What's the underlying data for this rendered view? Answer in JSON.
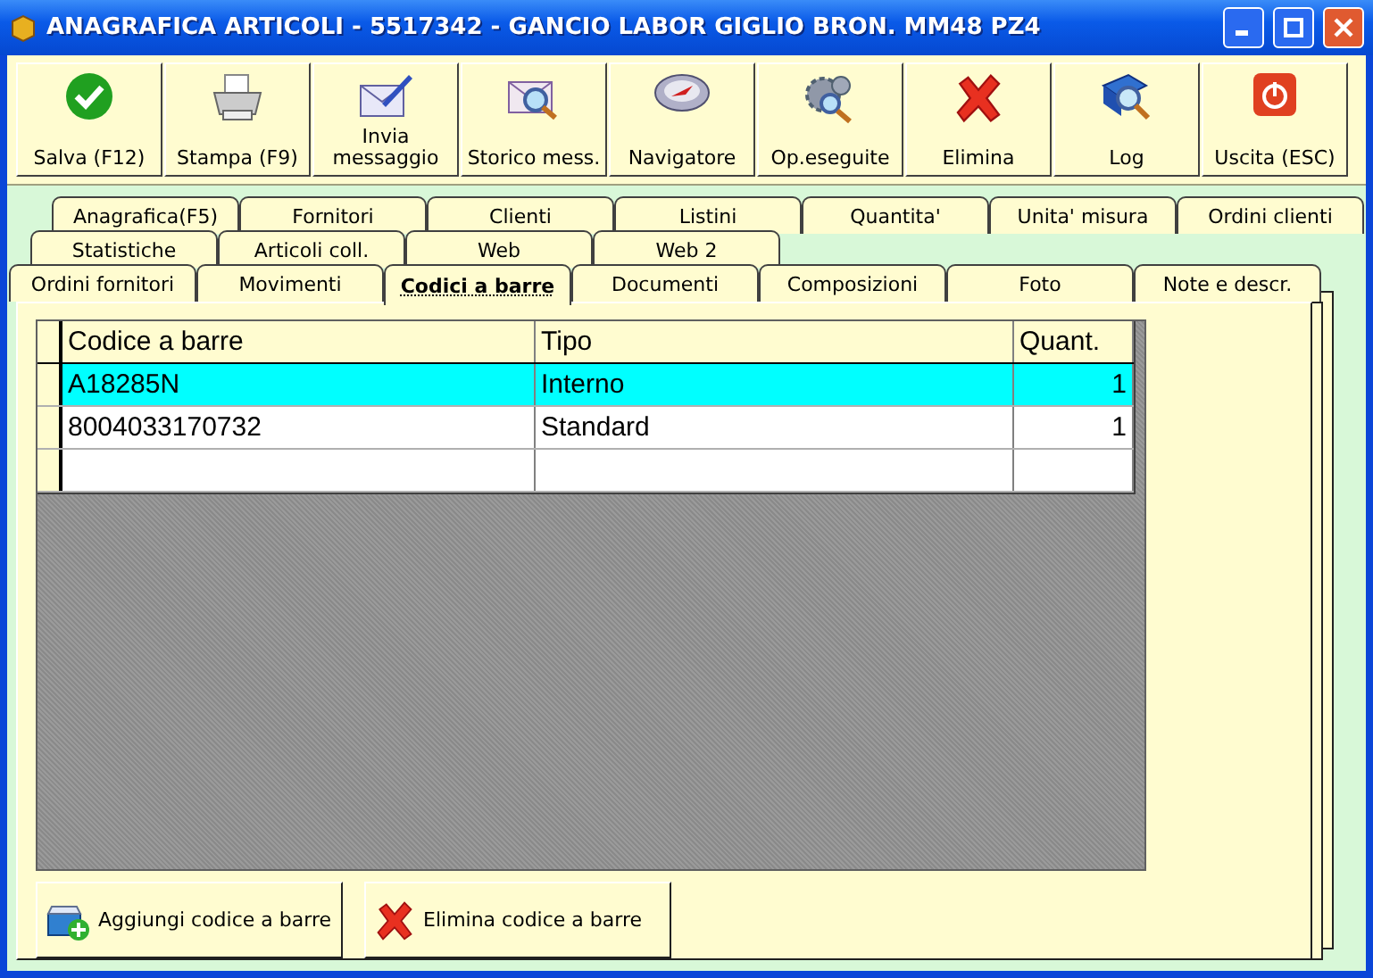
{
  "window": {
    "title": "ANAGRAFICA ARTICOLI - 5517342 - GANCIO LABOR  GIGLIO BRON. MM48 PZ4"
  },
  "toolbar": [
    {
      "label": "Salva (F12)"
    },
    {
      "label": "Stampa (F9)"
    },
    {
      "label": "Invia messaggio"
    },
    {
      "label": "Storico mess."
    },
    {
      "label": "Navigatore"
    },
    {
      "label": "Op.eseguite"
    },
    {
      "label": "Elimina"
    },
    {
      "label": "Log"
    },
    {
      "label": "Uscita (ESC)"
    }
  ],
  "tab_rows": [
    [
      {
        "label": "Anagrafica(F5)",
        "selected": false
      },
      {
        "label": "Fornitori",
        "selected": false
      },
      {
        "label": "Clienti",
        "selected": false
      },
      {
        "label": "Listini",
        "selected": false
      },
      {
        "label": "Quantita'",
        "selected": false
      },
      {
        "label": "Unita' misura",
        "selected": false
      },
      {
        "label": "Ordini clienti",
        "selected": false
      }
    ],
    [
      {
        "label": "Statistiche",
        "selected": false
      },
      {
        "label": "Articoli coll.",
        "selected": false
      },
      {
        "label": "Web",
        "selected": false
      },
      {
        "label": "Web 2",
        "selected": false
      }
    ],
    [
      {
        "label": "Ordini fornitori",
        "selected": false
      },
      {
        "label": "Movimenti",
        "selected": false
      },
      {
        "label": "Codici a barre",
        "selected": true
      },
      {
        "label": "Documenti",
        "selected": false
      },
      {
        "label": "Composizioni",
        "selected": false
      },
      {
        "label": "Foto",
        "selected": false
      },
      {
        "label": "Note e descr.",
        "selected": false
      }
    ]
  ],
  "table": {
    "columns": [
      "Codice a barre",
      "Tipo",
      "Quant."
    ],
    "rows": [
      {
        "cells": [
          "A18285N",
          "Interno",
          "1"
        ],
        "selected": true
      },
      {
        "cells": [
          "8004033170732",
          "Standard",
          "1"
        ],
        "selected": false
      }
    ]
  },
  "buttons": [
    {
      "label": "Aggiungi codice a barre"
    },
    {
      "label": "Elimina codice a barre"
    }
  ]
}
